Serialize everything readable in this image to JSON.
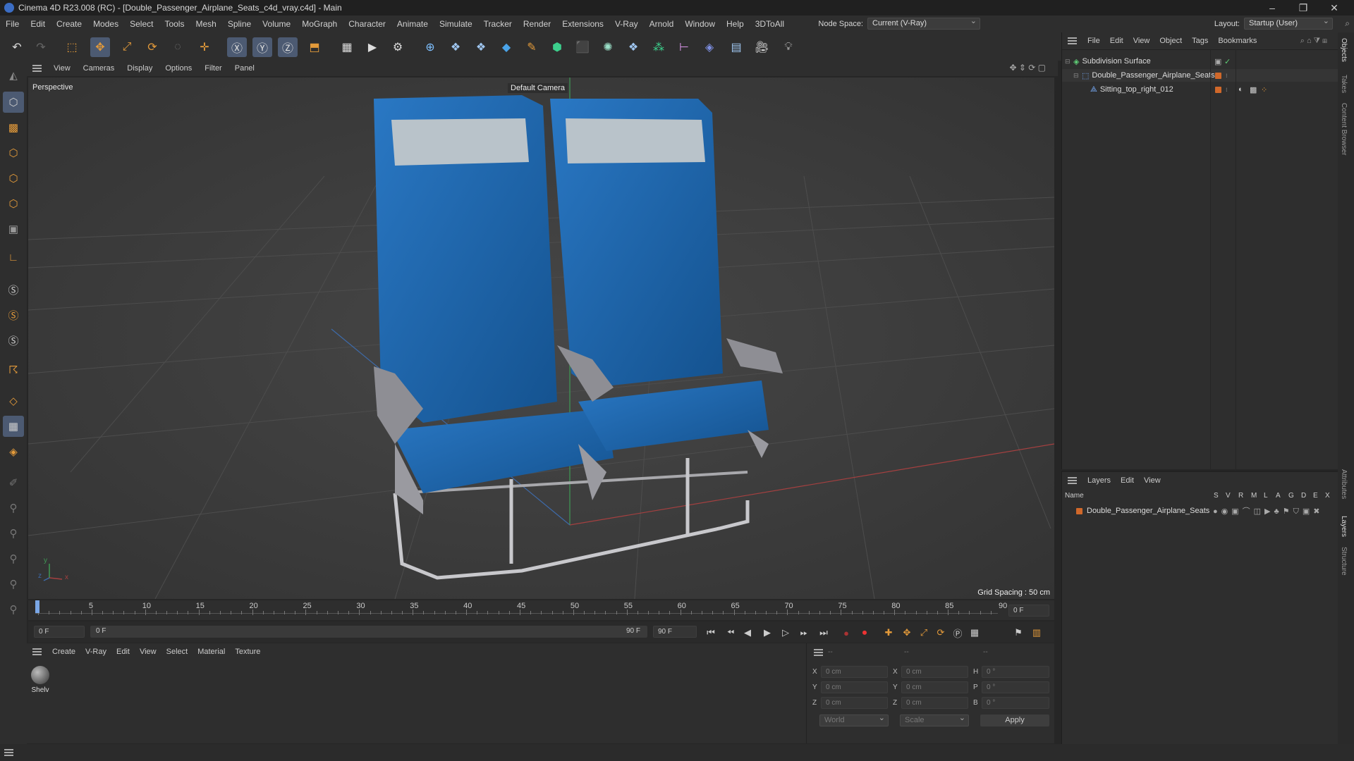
{
  "window": {
    "title": "Cinema 4D R23.008 (RC) - [Double_Passenger_Airplane_Seats_c4d_vray.c4d] - Main",
    "controls": [
      "–",
      "❐",
      "✕"
    ]
  },
  "menubar": {
    "items": [
      "File",
      "Edit",
      "Create",
      "Modes",
      "Select",
      "Tools",
      "Mesh",
      "Spline",
      "Volume",
      "MoGraph",
      "Character",
      "Animate",
      "Simulate",
      "Tracker",
      "Render",
      "Extensions",
      "V-Ray",
      "Arnold",
      "Window",
      "Help",
      "3DToAll"
    ],
    "node_space_label": "Node Space:",
    "node_space_value": "Current (V-Ray)",
    "layout_label": "Layout:",
    "layout_value": "Startup (User)"
  },
  "viewport": {
    "menu": [
      "View",
      "Cameras",
      "Display",
      "Options",
      "Filter",
      "Panel"
    ],
    "label": "Perspective",
    "camera": "Default Camera",
    "grid_spacing": "Grid Spacing : 50 cm",
    "axis_y": "y",
    "axis_x": "x",
    "axis_z": "z",
    "colors": {
      "seat_blue": "#1f66b0",
      "headrest": "#b9c3ca",
      "frame": "#b9b9bd"
    }
  },
  "timeline": {
    "ticks": [
      "0",
      "5",
      "10",
      "15",
      "20",
      "25",
      "30",
      "35",
      "40",
      "45",
      "50",
      "55",
      "60",
      "65",
      "70",
      "75",
      "80",
      "85",
      "90"
    ],
    "frame_field": "0 F",
    "start_field": "0 F",
    "range_start": "0 F",
    "range_end_label": "90 F",
    "end_field": "90 F"
  },
  "materials": {
    "menu": [
      "Create",
      "V-Ray",
      "Edit",
      "View",
      "Select",
      "Material",
      "Texture"
    ],
    "items": [
      {
        "name": "Shelv"
      }
    ]
  },
  "coords": {
    "header": [
      "--",
      "--",
      "--"
    ],
    "rows": [
      {
        "l1": "X",
        "v1": "0 cm",
        "l2": "X",
        "v2": "0 cm",
        "l3": "H",
        "v3": "0 °"
      },
      {
        "l1": "Y",
        "v1": "0 cm",
        "l2": "Y",
        "v2": "0 cm",
        "l3": "P",
        "v3": "0 °"
      },
      {
        "l1": "Z",
        "v1": "0 cm",
        "l2": "Z",
        "v2": "0 cm",
        "l3": "B",
        "v3": "0 °"
      }
    ],
    "space": "World",
    "mode": "Scale",
    "apply": "Apply"
  },
  "objects": {
    "menu": [
      "File",
      "Edit",
      "View",
      "Object",
      "Tags",
      "Bookmarks"
    ],
    "tree": [
      {
        "name": "Subdivision Surface",
        "indent": 0
      },
      {
        "name": "Double_Passenger_Airplane_Seats",
        "indent": 1
      },
      {
        "name": "Sitting_top_right_012",
        "indent": 2
      }
    ]
  },
  "layers": {
    "menu": [
      "Layers",
      "Edit",
      "View"
    ],
    "columns": [
      "Name",
      "S",
      "V",
      "R",
      "M",
      "L",
      "A",
      "G",
      "D",
      "E",
      "X"
    ],
    "rows": [
      {
        "name": "Double_Passenger_Airplane_Seats",
        "color": "#d0682a"
      }
    ]
  },
  "right_tabs": [
    "Objects",
    "Takes",
    "Content Browser",
    "Attributes",
    "Layers",
    "Structure"
  ]
}
